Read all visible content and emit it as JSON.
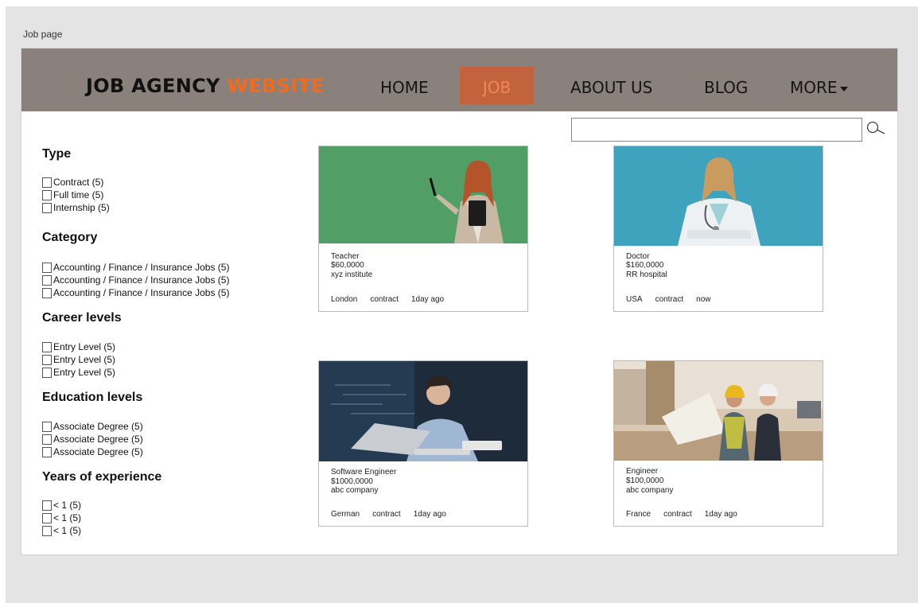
{
  "page_label": "Job page",
  "brand": {
    "name": "JOB AGENCY",
    "accent": "WEBSITE",
    "accent_color": "#f26a1b"
  },
  "nav": {
    "home": "HOME",
    "job": "JOB",
    "about": "ABOUT US",
    "blog": "BLOG",
    "more": "MORE"
  },
  "search": {
    "value": "",
    "placeholder": "",
    "icon": "search-icon"
  },
  "filters": [
    {
      "title": "Type",
      "options": [
        "Contract (5)",
        "Full time (5)",
        "Internship (5)"
      ]
    },
    {
      "title": "Category",
      "options": [
        "Accounting / Finance / Insurance Jobs (5)",
        "Accounting / Finance / Insurance Jobs (5)",
        "Accounting / Finance / Insurance Jobs (5)"
      ]
    },
    {
      "title": "Career levels",
      "options": [
        "Entry Level (5)",
        "Entry Level (5)",
        "Entry Level (5)"
      ]
    },
    {
      "title": "Education levels",
      "options": [
        "Associate Degree (5)",
        "Associate Degree (5)",
        "Associate Degree (5)"
      ]
    },
    {
      "title": "Years of experience",
      "options": [
        "< 1 (5)",
        "< 1 (5)",
        "< 1 (5)"
      ]
    }
  ],
  "jobs": [
    {
      "title": "Teacher",
      "salary": "$60,0000",
      "company": "xyz institute",
      "location": "London",
      "type": "contract",
      "posted": "1day ago"
    },
    {
      "title": "Doctor",
      "salary": "$160,0000",
      "company": "RR hospital",
      "location": "USA",
      "type": "contract",
      "posted": "now"
    },
    {
      "title": "Software Engineer",
      "salary": "$1000,0000",
      "company": "abc company",
      "location": "German",
      "type": "contract",
      "posted": "1day ago"
    },
    {
      "title": "Engineer",
      "salary": "$100,0000",
      "company": "abc company",
      "location": "France",
      "type": "contract",
      "posted": "1day ago"
    }
  ]
}
